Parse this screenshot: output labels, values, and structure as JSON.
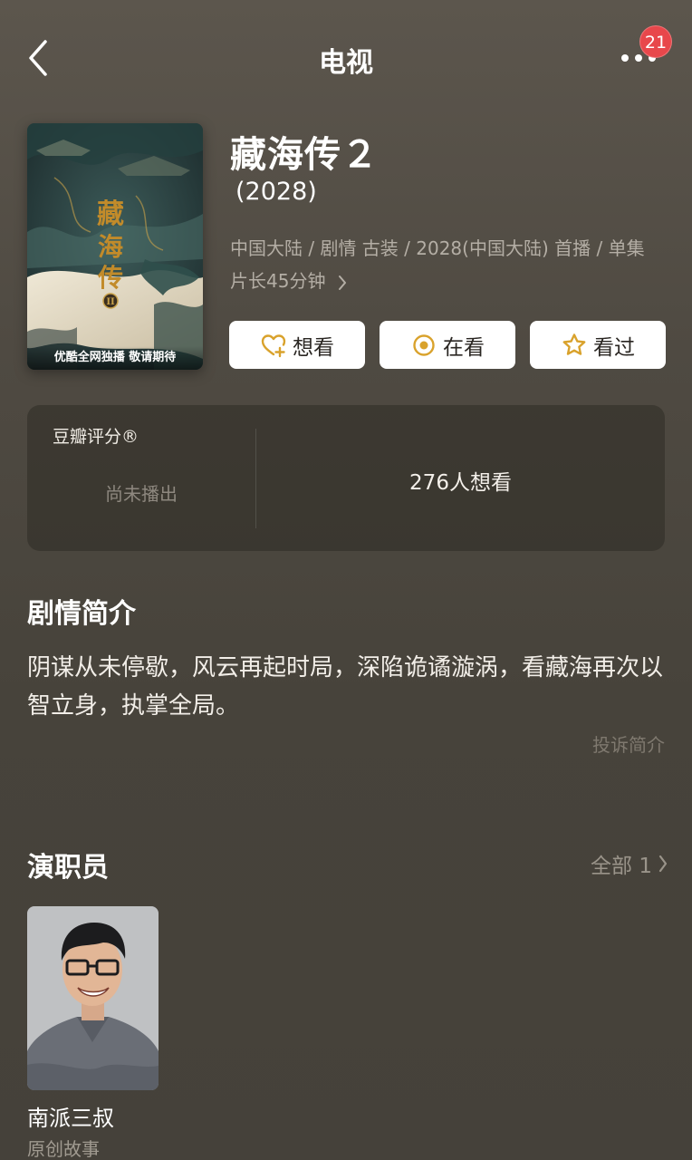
{
  "nav": {
    "title": "电视",
    "back_icon": "chevron-left-icon",
    "more_icon": "more-dots-icon",
    "notification_count": "21"
  },
  "poster": {
    "title_art": "藏海传",
    "numeral": "II",
    "caption": "优酷全网独播 敬请期待"
  },
  "show": {
    "title": "藏海传２",
    "year": " (2028)",
    "meta_line1": "中国大陆 / 剧情 古装 / 2028(中国大陆) 首播 / 单集",
    "meta_line2": "片长45分钟"
  },
  "actions": [
    {
      "label": "想看",
      "icon": "heart-plus-icon"
    },
    {
      "label": "在看",
      "icon": "target-circle-icon"
    },
    {
      "label": "看过",
      "icon": "star-icon"
    }
  ],
  "rating": {
    "label": "豆瓣评分®",
    "status": "尚未播出",
    "want_count": "276人想看"
  },
  "plot": {
    "heading": "剧情简介",
    "text": "阴谋从未停歇，风云再起时局，深陷诡谲漩涡，看藏海再次以智立身，执掌全局。",
    "report_link": "投诉简介"
  },
  "cast": {
    "heading": "演职员",
    "see_all": "全部 1",
    "members": [
      {
        "name": "南派三叔",
        "role": "原创故事"
      }
    ]
  },
  "colors": {
    "background": "#4f4a42",
    "accent": "#d9a22c",
    "badge": "#e8474b"
  }
}
